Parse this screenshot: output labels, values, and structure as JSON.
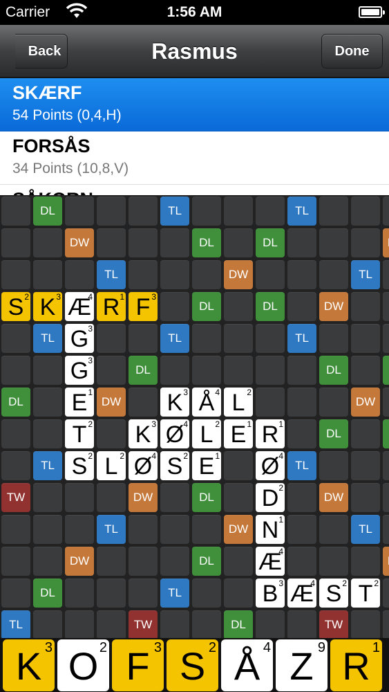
{
  "status": {
    "carrier": "Carrier",
    "time": "1:56 AM"
  },
  "nav": {
    "back_label": "Back",
    "title": "Rasmus",
    "done_label": "Done"
  },
  "words": [
    {
      "word": "SKÆRF",
      "points": "54 Points (0,4,H)",
      "selected": true
    },
    {
      "word": "FORSÅS",
      "points": "34 Points (10,8,V)",
      "selected": false
    },
    {
      "word": "SÅKORN",
      "points": "",
      "selected": false,
      "partial": true
    }
  ],
  "board": {
    "bonuses": [
      [
        0,
        1,
        "DL"
      ],
      [
        0,
        5,
        "TL"
      ],
      [
        0,
        9,
        "TL"
      ],
      [
        1,
        2,
        "DW"
      ],
      [
        1,
        6,
        "DL"
      ],
      [
        1,
        8,
        "DL"
      ],
      [
        1,
        12,
        "DW"
      ],
      [
        2,
        3,
        "TL"
      ],
      [
        2,
        7,
        "DW"
      ],
      [
        2,
        11,
        "TL"
      ],
      [
        3,
        6,
        "DL"
      ],
      [
        3,
        8,
        "DL"
      ],
      [
        3,
        10,
        "DW"
      ],
      [
        4,
        1,
        "TL"
      ],
      [
        4,
        5,
        "TL"
      ],
      [
        4,
        9,
        "TL"
      ],
      [
        5,
        4,
        "DL"
      ],
      [
        5,
        10,
        "DL"
      ],
      [
        5,
        12,
        "DL"
      ],
      [
        6,
        0,
        "DL"
      ],
      [
        6,
        3,
        "DW"
      ],
      [
        6,
        11,
        "DW"
      ],
      [
        7,
        10,
        "DL"
      ],
      [
        7,
        12,
        "DL"
      ],
      [
        8,
        1,
        "TL"
      ],
      [
        8,
        9,
        "TL"
      ],
      [
        9,
        0,
        "TW"
      ],
      [
        9,
        4,
        "DW"
      ],
      [
        9,
        6,
        "DL"
      ],
      [
        9,
        10,
        "DW"
      ],
      [
        10,
        3,
        "TL"
      ],
      [
        10,
        7,
        "DW"
      ],
      [
        10,
        11,
        "TL"
      ],
      [
        11,
        2,
        "DW"
      ],
      [
        11,
        6,
        "DL"
      ],
      [
        11,
        12,
        "DW"
      ],
      [
        12,
        1,
        "DL"
      ],
      [
        12,
        5,
        "TL"
      ],
      [
        13,
        0,
        "TL"
      ],
      [
        13,
        4,
        "TW"
      ],
      [
        13,
        7,
        "DL"
      ],
      [
        13,
        10,
        "TW"
      ]
    ],
    "tiles": [
      [
        3,
        0,
        "S",
        "2",
        true
      ],
      [
        3,
        1,
        "K",
        "3",
        true
      ],
      [
        3,
        2,
        "Æ",
        "4",
        false
      ],
      [
        3,
        3,
        "R",
        "1",
        true
      ],
      [
        3,
        4,
        "F",
        "3",
        true
      ],
      [
        4,
        2,
        "G",
        "3",
        false
      ],
      [
        5,
        2,
        "G",
        "3",
        false
      ],
      [
        6,
        2,
        "E",
        "1",
        false
      ],
      [
        7,
        2,
        "T",
        "2",
        false
      ],
      [
        6,
        5,
        "K",
        "3",
        false
      ],
      [
        6,
        6,
        "Å",
        "4",
        false
      ],
      [
        6,
        7,
        "L",
        "2",
        false
      ],
      [
        7,
        4,
        "K",
        "3",
        false
      ],
      [
        7,
        5,
        "Ø",
        "4",
        false
      ],
      [
        7,
        6,
        "L",
        "2",
        false
      ],
      [
        7,
        7,
        "E",
        "1",
        false
      ],
      [
        7,
        8,
        "R",
        "1",
        false
      ],
      [
        8,
        2,
        "S",
        "2",
        false
      ],
      [
        8,
        3,
        "L",
        "2",
        false
      ],
      [
        8,
        4,
        "Ø",
        "4",
        false
      ],
      [
        8,
        5,
        "S",
        "2",
        false
      ],
      [
        8,
        6,
        "E",
        "1",
        false
      ],
      [
        8,
        8,
        "Ø",
        "4",
        false
      ],
      [
        9,
        8,
        "D",
        "2",
        false
      ],
      [
        10,
        8,
        "N",
        "1",
        false
      ],
      [
        11,
        8,
        "Æ",
        "4",
        false
      ],
      [
        12,
        8,
        "B",
        "3",
        false
      ],
      [
        12,
        9,
        "Æ",
        "4",
        false
      ],
      [
        12,
        10,
        "S",
        "2",
        false
      ],
      [
        12,
        11,
        "T",
        "2",
        false
      ]
    ]
  },
  "rack": [
    {
      "letter": "K",
      "score": "3",
      "color": "yellow"
    },
    {
      "letter": "O",
      "score": "2",
      "color": "white"
    },
    {
      "letter": "F",
      "score": "3",
      "color": "yellow"
    },
    {
      "letter": "S",
      "score": "2",
      "color": "yellow"
    },
    {
      "letter": "Å",
      "score": "4",
      "color": "white"
    },
    {
      "letter": "Z",
      "score": "9",
      "color": "white"
    },
    {
      "letter": "R",
      "score": "1",
      "color": "yellow"
    }
  ]
}
